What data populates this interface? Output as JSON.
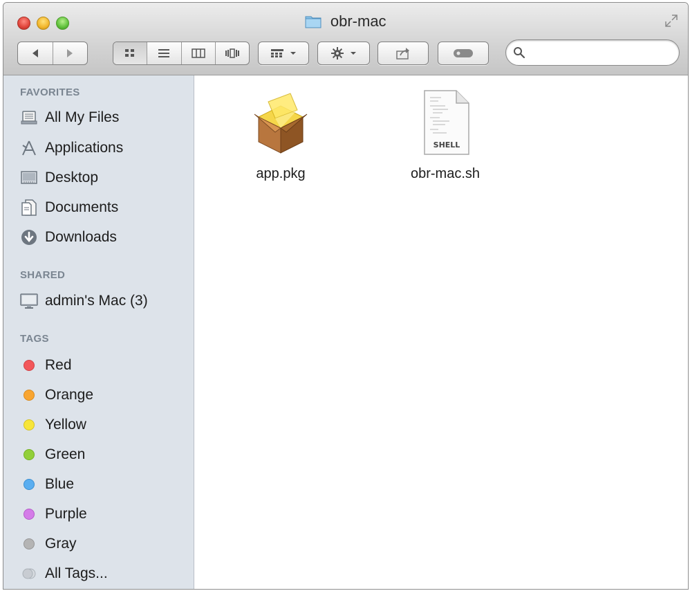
{
  "window": {
    "title": "obr-mac"
  },
  "toolbar": {
    "search_placeholder": ""
  },
  "sidebar": {
    "favorites_heading": "FAVORITES",
    "favorites": [
      {
        "label": "All My Files",
        "icon": "all-my-files-icon"
      },
      {
        "label": "Applications",
        "icon": "applications-icon"
      },
      {
        "label": "Desktop",
        "icon": "desktop-icon"
      },
      {
        "label": "Documents",
        "icon": "documents-icon"
      },
      {
        "label": "Downloads",
        "icon": "downloads-icon"
      }
    ],
    "shared_heading": "SHARED",
    "shared": [
      {
        "label": "admin's Mac (3)",
        "icon": "computer-icon"
      }
    ],
    "tags_heading": "TAGS",
    "tags": [
      {
        "label": "Red",
        "color": "#f2575a"
      },
      {
        "label": "Orange",
        "color": "#f8a531"
      },
      {
        "label": "Yellow",
        "color": "#f7e53a"
      },
      {
        "label": "Green",
        "color": "#92cf3a"
      },
      {
        "label": "Blue",
        "color": "#5aaef0"
      },
      {
        "label": "Purple",
        "color": "#d47ce8"
      },
      {
        "label": "Gray",
        "color": "#b4b4b4"
      },
      {
        "label": "All Tags...",
        "color": "#c8ccd2"
      }
    ]
  },
  "files": [
    {
      "name": "app.pkg",
      "icon": "package-icon"
    },
    {
      "name": "obr-mac.sh",
      "icon": "shell-script-icon",
      "badge": "SHELL"
    }
  ]
}
